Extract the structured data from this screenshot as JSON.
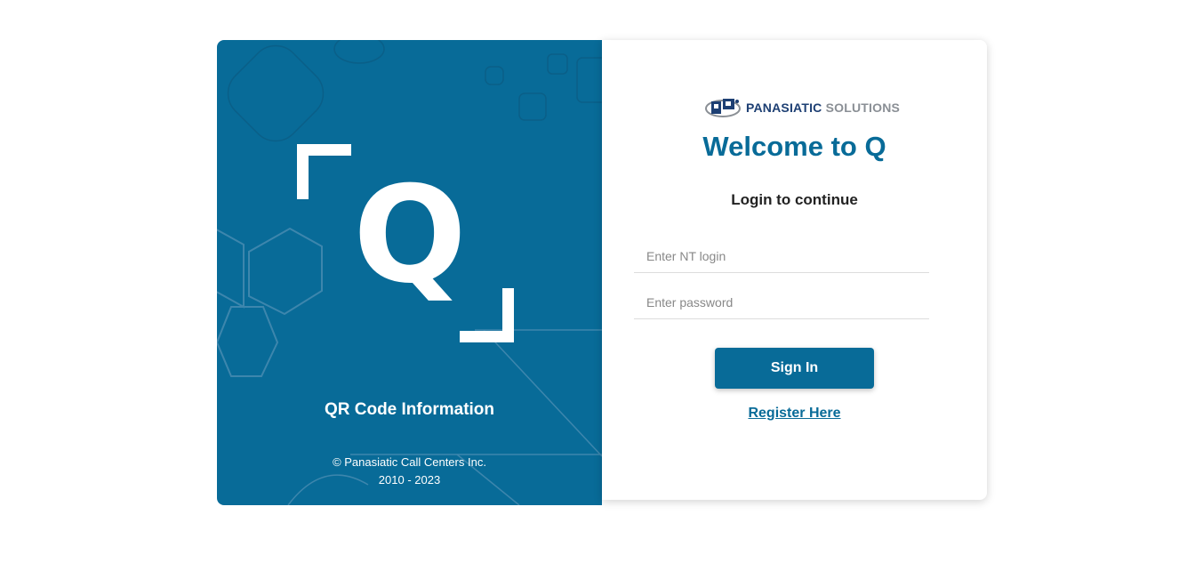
{
  "left_panel": {
    "logo_letter": "Q",
    "title": "QR Code Information",
    "copyright_line1": "© Panasiatic Call Centers Inc.",
    "copyright_line2": "2010 - 2023"
  },
  "right_panel": {
    "brand_name": "PANASIATIC",
    "brand_suffix": "SOLUTIONS",
    "welcome": "Welcome to Q",
    "subtitle": "Login to continue",
    "login_placeholder": "Enter NT login",
    "password_placeholder": "Enter password",
    "signin_label": "Sign In",
    "register_label": "Register Here"
  },
  "colors": {
    "primary": "#086b98",
    "brand_dark": "#1d3f73",
    "brand_grey": "#8a8f95"
  }
}
